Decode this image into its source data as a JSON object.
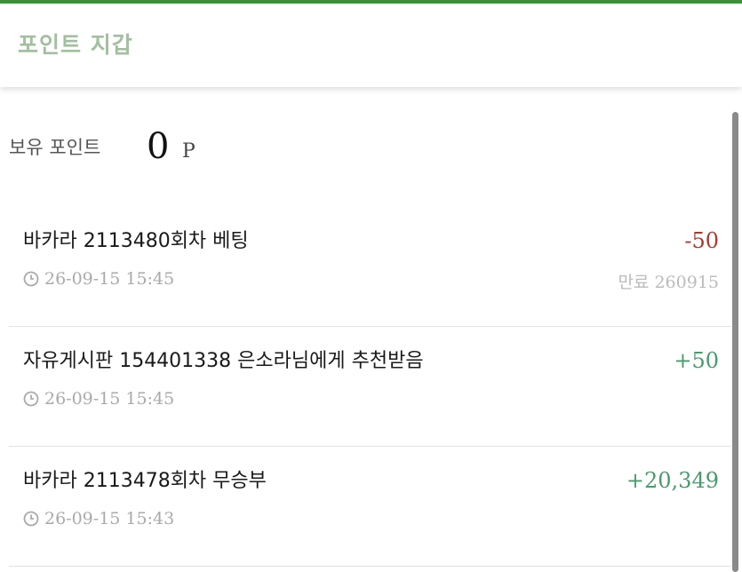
{
  "header": {
    "title": "포인트 지갑"
  },
  "balance": {
    "label": "보유 포인트",
    "value": "0",
    "unit": "P"
  },
  "transactions": [
    {
      "title": "바카라 2113480회차 베팅",
      "amount": "-50",
      "time": "26-09-15 15:45",
      "expire_label": "만료",
      "expire_value": "260915"
    },
    {
      "title": "자유게시판 154401338 은소라님에게 추천받음",
      "amount": "+50",
      "time": "26-09-15 15:45"
    },
    {
      "title": "바카라 2113478회차 무승부",
      "amount": "+20,349",
      "time": "26-09-15 15:43"
    }
  ],
  "colors": {
    "accent_bar": "#3f8f3a",
    "title": "#a3bfa0",
    "negative": "#a63c2e",
    "positive": "#4a9a6c"
  },
  "icons": {
    "time": "clock-icon"
  }
}
